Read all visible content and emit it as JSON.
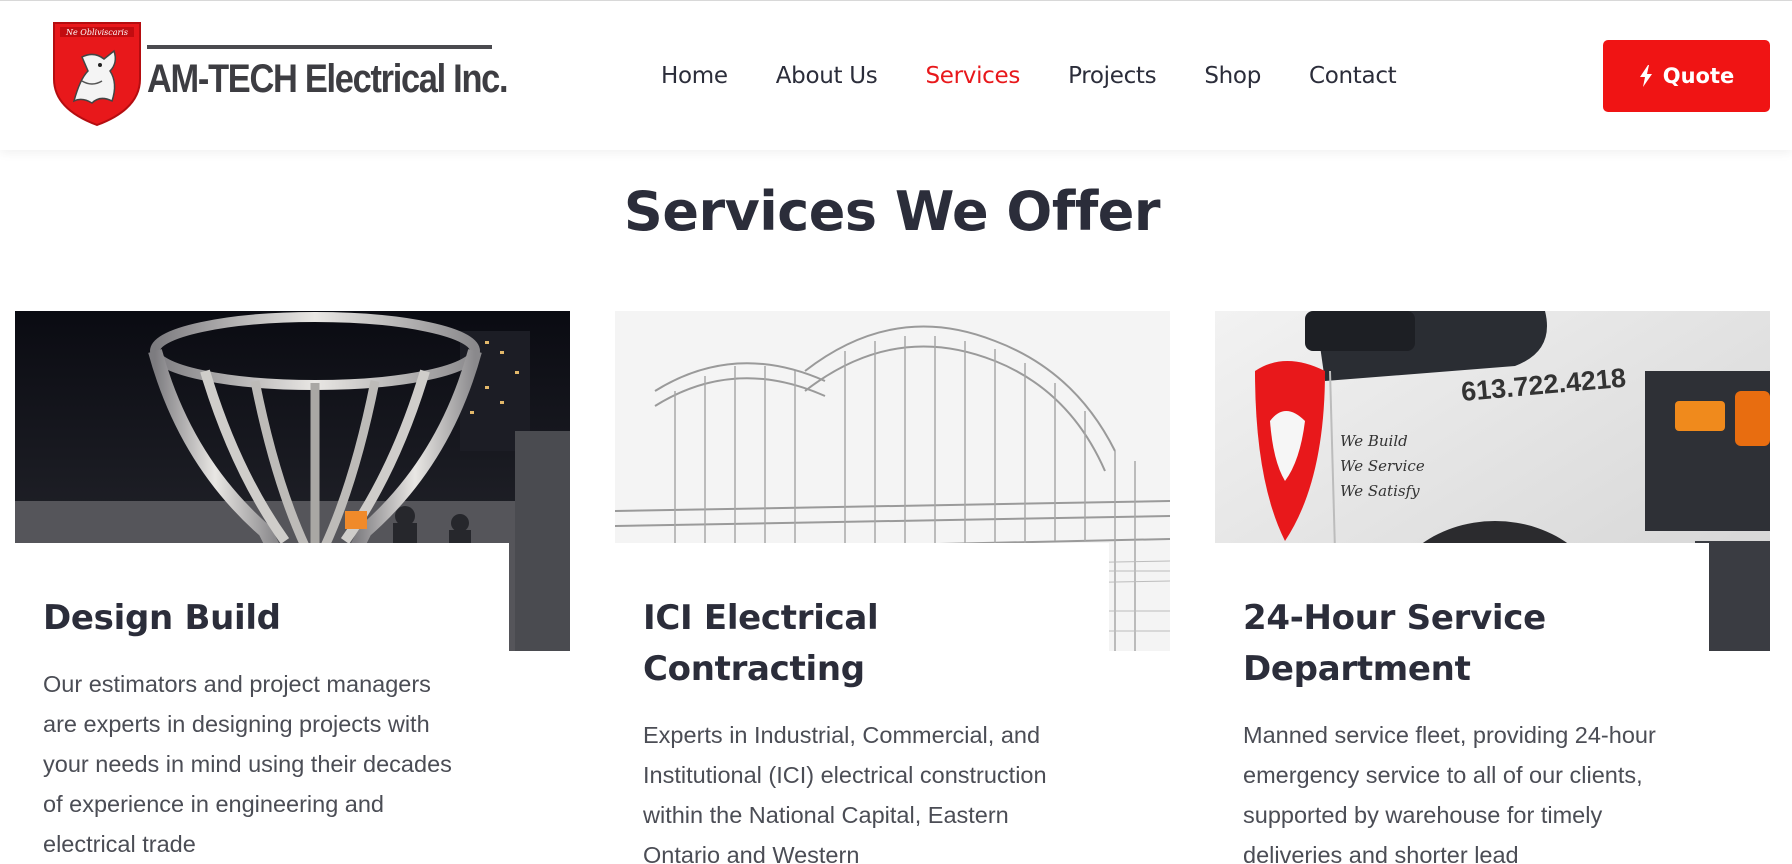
{
  "brand": {
    "logo_text": "AM-TECH Electrical Inc.",
    "motto": "Ne Obliviscaris",
    "accent_color": "#e8181b"
  },
  "nav": {
    "items": [
      {
        "label": "Home"
      },
      {
        "label": "About Us"
      },
      {
        "label": "Services"
      },
      {
        "label": "Projects"
      },
      {
        "label": "Shop"
      },
      {
        "label": "Contact"
      }
    ],
    "active": "Services"
  },
  "quote_button": {
    "label": "Quote",
    "icon": "lightning-icon"
  },
  "section": {
    "title": "Services We Offer"
  },
  "cards": [
    {
      "title": "Design Build",
      "text": "Our estimators and project managers are experts in designing projects with your needs in mind using their decades of experience in engineering and electrical trade",
      "image": "sculpture-photo"
    },
    {
      "title": "ICI Electrical Contracting",
      "text": "Experts in Industrial, Commercial, and Institutional (ICI) electrical construction within the National Capital, Eastern Ontario and Western",
      "image": "building-sketch"
    },
    {
      "title": "24-Hour Service Department",
      "text": "Manned service fleet, providing 24-hour emergency service to all of our clients, supported by warehouse for timely deliveries and shorter lead",
      "image": "service-van-photo",
      "van_phone": "613.722.4218",
      "van_slogans": [
        "We Build",
        "We Service",
        "We Satisfy"
      ]
    }
  ]
}
